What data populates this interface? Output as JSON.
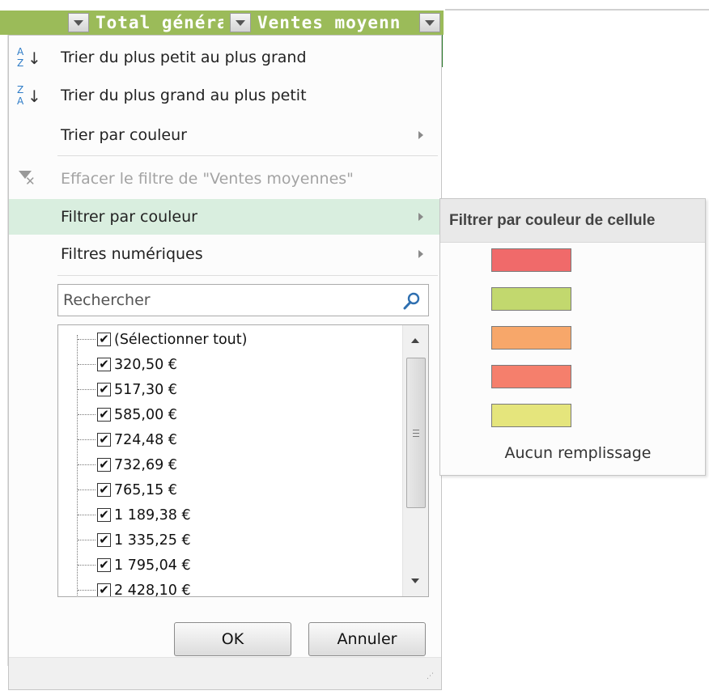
{
  "header": {
    "col_total": "Total généra",
    "col_ventes": "Ventes moyenn"
  },
  "menu": {
    "items": [
      {
        "label": "Trier du plus petit au plus grand",
        "icon": "sort-ascending-icon",
        "disabled": false
      },
      {
        "label": "Trier du plus grand au plus petit",
        "icon": "sort-descending-icon",
        "disabled": false
      },
      {
        "label": "Trier par couleur",
        "icon": "",
        "disabled": false,
        "submenu": true
      },
      {
        "label": "Effacer le filtre de \"Ventes moyennes\"",
        "icon": "clear-filter-icon",
        "disabled": true
      },
      {
        "label": "Filtrer par couleur",
        "icon": "",
        "disabled": false,
        "submenu": true,
        "highlighted": true
      },
      {
        "label": "Filtres numériques",
        "icon": "",
        "disabled": false,
        "submenu": true
      }
    ]
  },
  "search": {
    "placeholder": "Rechercher",
    "icon": "magnifier-icon"
  },
  "list": {
    "items": [
      {
        "label": "(Sélectionner tout)",
        "checked": true
      },
      {
        "label": "320,50 €",
        "checked": true
      },
      {
        "label": "517,30 €",
        "checked": true
      },
      {
        "label": "585,00 €",
        "checked": true
      },
      {
        "label": "724,48 €",
        "checked": true
      },
      {
        "label": "732,69 €",
        "checked": true
      },
      {
        "label": "765,15 €",
        "checked": true
      },
      {
        "label": "1 189,38 €",
        "checked": true
      },
      {
        "label": "1 335,25 €",
        "checked": true
      },
      {
        "label": "1 795,04 €",
        "checked": true
      },
      {
        "label": "2 428,10 €",
        "checked": true
      }
    ]
  },
  "buttons": {
    "ok": "OK",
    "cancel": "Annuler"
  },
  "submenu": {
    "title": "Filtrer par couleur de cellule",
    "colors": [
      "#f06a6a",
      "#c2d86e",
      "#f7a76a",
      "#f57f6c",
      "#e5e57c"
    ],
    "no_fill": "Aucun remplissage"
  },
  "colors": {
    "header_green": "#9bbb59",
    "highlight": "#d9eedf",
    "grid_green": "#2c7a2c"
  }
}
